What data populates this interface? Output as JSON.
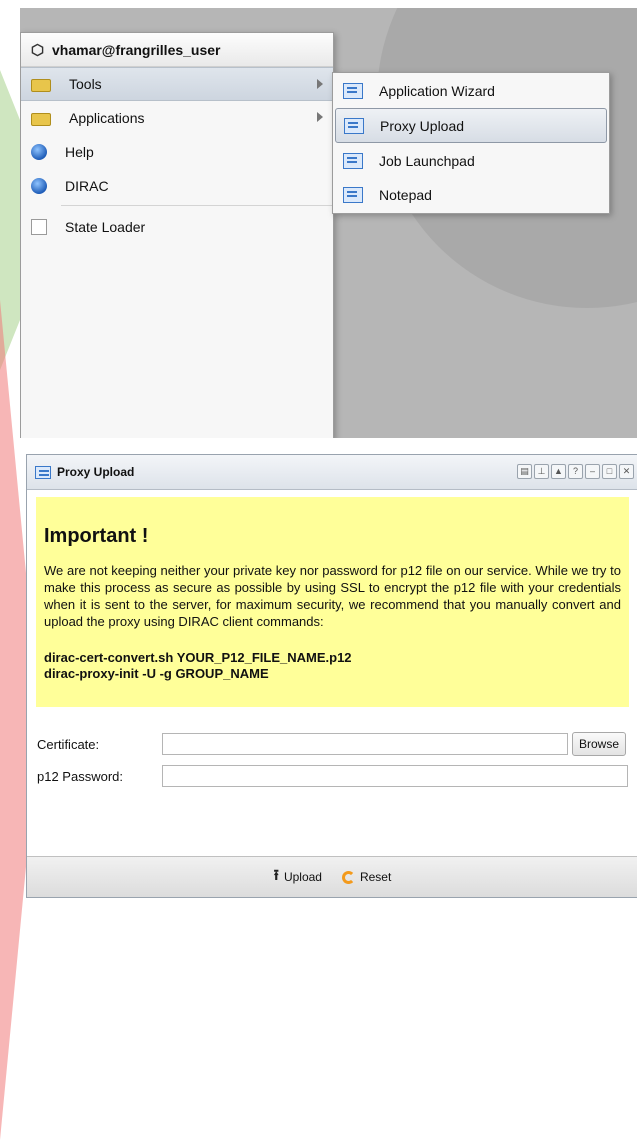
{
  "menu": {
    "user": "vhamar@frangrilles_user",
    "items": [
      {
        "label": "Tools",
        "icon": "folder-icon",
        "has_submenu": true
      },
      {
        "label": "Applications",
        "icon": "folder-icon",
        "has_submenu": true
      },
      {
        "label": "Help",
        "icon": "globe-icon",
        "has_submenu": false
      },
      {
        "label": "DIRAC",
        "icon": "globe-icon",
        "has_submenu": false
      }
    ],
    "state_loader": "State Loader"
  },
  "submenu": {
    "items": [
      {
        "label": "Application Wizard"
      },
      {
        "label": "Proxy Upload"
      },
      {
        "label": "Job Launchpad"
      },
      {
        "label": "Notepad"
      }
    ],
    "active": "Proxy Upload"
  },
  "window": {
    "title": "Proxy Upload",
    "notice": {
      "heading": "Important !",
      "text": "We are not keeping neither your private key nor password for p12 file on our service. While we try to make this process as secure as possible by using SSL to encrypt the p12 file with your credentials when it is sent to the server, for maximum security, we recommend that you manually convert and upload the proxy using DIRAC client commands:",
      "cmd1": "dirac-cert-convert.sh YOUR_P12_FILE_NAME.p12",
      "cmd2": "dirac-proxy-init -U -g GROUP_NAME"
    },
    "certificate_label": "Certificate:",
    "certificate_value": "",
    "browse_label": "Browse",
    "password_label": "p12 Password:",
    "password_value": "",
    "upload_label": "Upload",
    "reset_label": "Reset"
  },
  "colors": {
    "notice_bg": "#ffff99",
    "accent": "#3a78c9"
  }
}
